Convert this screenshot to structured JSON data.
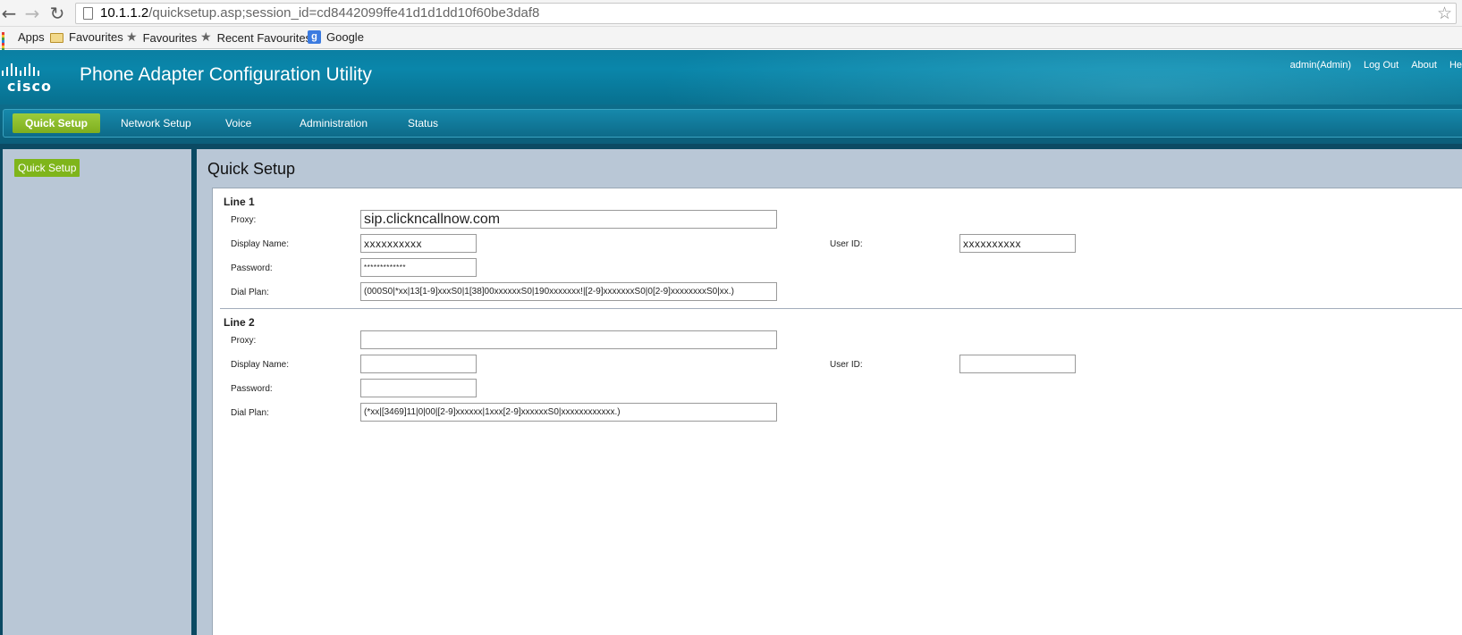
{
  "browser": {
    "url_host": "10.1.1.2",
    "url_path": "/quicksetup.asp;session_id=cd8442099ffe41d1d1dd10f60be3daf8",
    "bookmarks": [
      {
        "label": "Apps",
        "icon": "apps-grid-icon"
      },
      {
        "label": "Favourites",
        "icon": "folder-icon"
      },
      {
        "label": "Favourites",
        "icon": "star-icon"
      },
      {
        "label": "Recent Favourites",
        "icon": "star-icon"
      },
      {
        "label": "Google",
        "icon": "google-icon"
      }
    ]
  },
  "header": {
    "logo_text": "cisco",
    "title": "Phone Adapter Configuration Utility",
    "links": {
      "user": "admin(Admin)",
      "logout": "Log Out",
      "about": "About",
      "help": "He"
    }
  },
  "menu": {
    "items": [
      "Quick Setup",
      "Network Setup",
      "Voice",
      "Administration",
      "Status"
    ],
    "active": "Quick Setup"
  },
  "sidebar": {
    "items": [
      {
        "label": "Quick Setup",
        "active": true
      }
    ]
  },
  "page": {
    "title": "Quick Setup"
  },
  "line1": {
    "title": "Line 1",
    "labels": {
      "proxy": "Proxy:",
      "display_name": "Display Name:",
      "user_id": "User ID:",
      "password": "Password:",
      "dial_plan": "Dial Plan:"
    },
    "proxy": "sip.clickncallnow.com",
    "display_name": "xxxxxxxxxx",
    "user_id": "xxxxxxxxxx",
    "password": "*************",
    "dial_plan": "(000S0|*xx|13[1-9]xxxS0|1[38]00xxxxxxS0|190xxxxxxx!|[2-9]xxxxxxxS0|0[2-9]xxxxxxxxS0|xx.)"
  },
  "line2": {
    "title": "Line 2",
    "labels": {
      "proxy": "Proxy:",
      "display_name": "Display Name:",
      "user_id": "User ID:",
      "password": "Password:",
      "dial_plan": "Dial Plan:"
    },
    "proxy": "",
    "display_name": "",
    "user_id": "",
    "password": "",
    "dial_plan": "(*xx|[3469]11|0|00|[2-9]xxxxxx|1xxx[2-9]xxxxxxS0|xxxxxxxxxxxx.)"
  },
  "colors": {
    "header_blue": "#0a86aa",
    "menu_active_green": "#8bbd2c",
    "sidebar_bg": "#b9c7d6",
    "frame_dark": "#0b4a63"
  }
}
